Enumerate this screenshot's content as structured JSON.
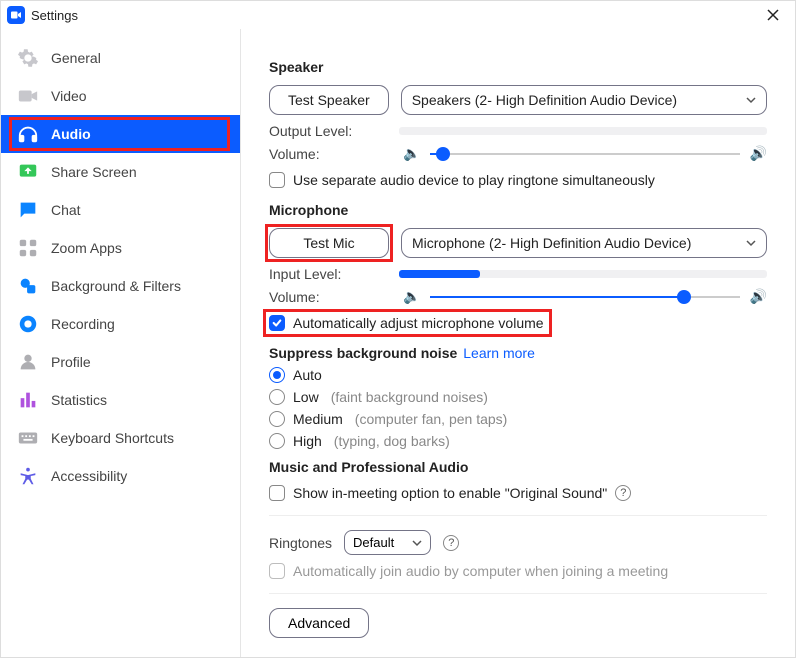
{
  "window": {
    "title": "Settings"
  },
  "sidebar": {
    "items": [
      {
        "label": "General",
        "icon": "gear",
        "color": "#c7c7cc"
      },
      {
        "label": "Video",
        "icon": "video",
        "color": "#c7c7cc"
      },
      {
        "label": "Audio",
        "icon": "audio",
        "color": "#ffffff",
        "active": true,
        "highlighted": true
      },
      {
        "label": "Share Screen",
        "icon": "share",
        "color": "#34c759"
      },
      {
        "label": "Chat",
        "icon": "chat",
        "color": "#0b84ff"
      },
      {
        "label": "Zoom Apps",
        "icon": "apps",
        "color": "#aeaeb2"
      },
      {
        "label": "Background & Filters",
        "icon": "filters",
        "color": "#0b84ff"
      },
      {
        "label": "Recording",
        "icon": "recording",
        "color": "#0b84ff"
      },
      {
        "label": "Profile",
        "icon": "profile",
        "color": "#aeaeb2"
      },
      {
        "label": "Statistics",
        "icon": "stats",
        "color": "#af52de"
      },
      {
        "label": "Keyboard Shortcuts",
        "icon": "keyboard",
        "color": "#aeaeb2"
      },
      {
        "label": "Accessibility",
        "icon": "accessibility",
        "color": "#5e5ce6"
      }
    ]
  },
  "speaker": {
    "title": "Speaker",
    "test_label": "Test Speaker",
    "device": "Speakers (2- High Definition Audio Device)",
    "output_level_label": "Output Level:",
    "output_level_percent": 0,
    "volume_label": "Volume:",
    "volume_percent": 4,
    "separate_label": "Use separate audio device to play ringtone simultaneously",
    "separate_checked": false
  },
  "microphone": {
    "title": "Microphone",
    "test_label": "Test Mic",
    "device": "Microphone (2- High Definition Audio Device)",
    "input_level_label": "Input Level:",
    "input_level_percent": 22,
    "volume_label": "Volume:",
    "volume_percent": 82,
    "auto_adjust_label": "Automatically adjust microphone volume",
    "auto_adjust_checked": true
  },
  "suppress": {
    "title": "Suppress background noise",
    "learn_more": "Learn more",
    "options": [
      {
        "label": "Auto",
        "hint": "",
        "selected": true
      },
      {
        "label": "Low",
        "hint": "(faint background noises)",
        "selected": false
      },
      {
        "label": "Medium",
        "hint": "(computer fan, pen taps)",
        "selected": false
      },
      {
        "label": "High",
        "hint": "(typing, dog barks)",
        "selected": false
      }
    ]
  },
  "music": {
    "title": "Music and Professional Audio",
    "original_sound_label": "Show in-meeting option to enable \"Original Sound\""
  },
  "ringtones": {
    "label": "Ringtones",
    "value": "Default"
  },
  "auto_join": {
    "label": "Automatically join audio by computer when joining a meeting"
  },
  "advanced": {
    "label": "Advanced"
  }
}
